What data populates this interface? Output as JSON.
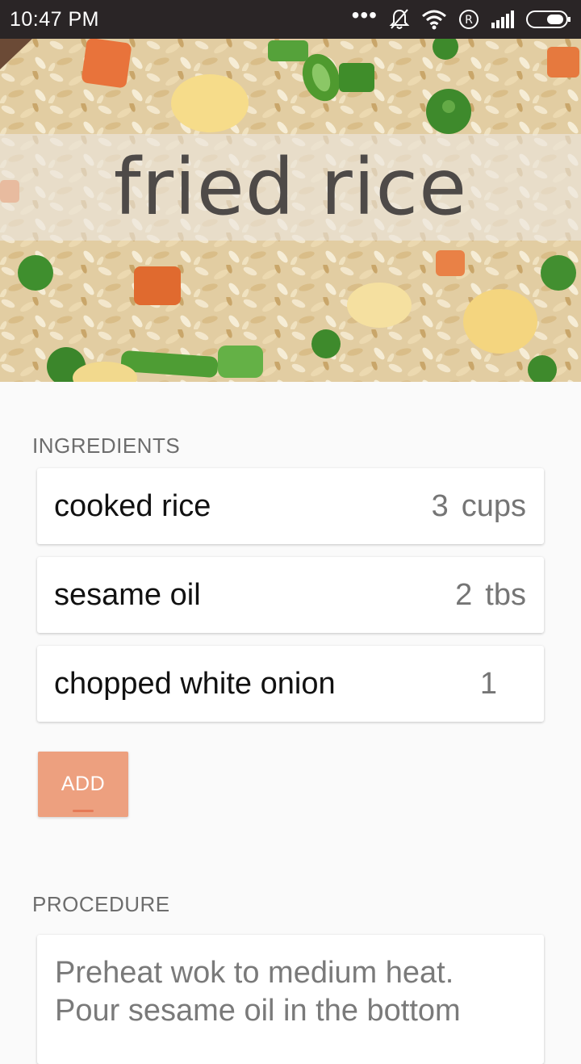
{
  "status_bar": {
    "time": "10:47  PM",
    "icons": [
      "more-dots-icon",
      "muted-bell-icon",
      "wifi-icon",
      "registered-icon",
      "signal-icon",
      "battery-icon"
    ]
  },
  "recipe": {
    "title": "fried rice"
  },
  "ingredients": {
    "section_label": "INGREDIENTS",
    "items": [
      {
        "name": "cooked rice",
        "amount": "3",
        "unit": "cups"
      },
      {
        "name": "sesame oil",
        "amount": "2",
        "unit": "tbs"
      },
      {
        "name": "chopped white onion",
        "amount": "1",
        "unit": ""
      }
    ],
    "add_label": "ADD"
  },
  "procedure": {
    "section_label": "PROCEDURE",
    "text": "Preheat wok to medium heat. Pour sesame oil in the bottom"
  },
  "colors": {
    "status_bar_bg": "#2a2526",
    "add_button_bg": "#eda07f",
    "page_bg": "#fafafa"
  }
}
